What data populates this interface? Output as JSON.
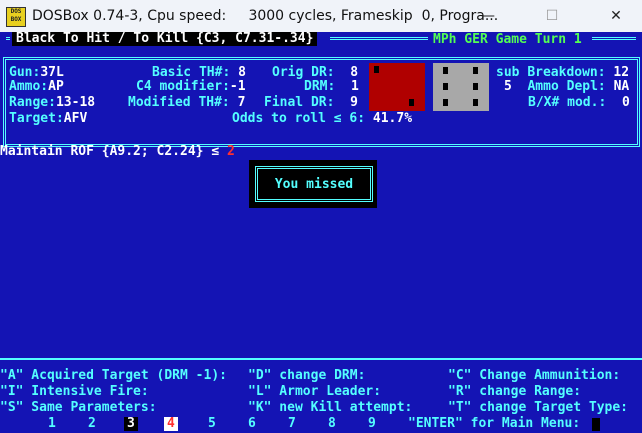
{
  "window": {
    "title": "DOSBox 0.74-3, Cpu speed:     3000 cycles, Frameskip  0, Progra...",
    "icon_text": "DOS BOX",
    "minimize": "—",
    "maximize": "☐",
    "close": "✕"
  },
  "header": {
    "title": "Black To Hit / To Kill {C3, C7.31-.34}",
    "turn": "MPh GER Game Turn 1"
  },
  "stats": {
    "gun_label": "Gun:",
    "gun_value": "37L",
    "ammo_label": "Ammo:",
    "ammo_value": "AP",
    "range_label": "Range:",
    "range_value": "13-18",
    "target_label": "Target:",
    "target_value": "AFV",
    "basic_th_label": "Basic TH#:",
    "basic_th_value": "8",
    "c4_label": "C4 modifier:",
    "c4_value": "-1",
    "modified_th_label": "Modified TH#:",
    "modified_th_value": "7",
    "orig_dr_label": "Orig DR:",
    "orig_dr_value": "8",
    "drm_label": "DRM:",
    "drm_value": "1",
    "final_dr_label": "Final DR:",
    "final_dr_value": "9",
    "odds_label": "Odds to roll ≤ 6:",
    "odds_value": "41.7%",
    "sub_label": "sub",
    "breakdown_label": "Breakdown:",
    "breakdown_value": "12",
    "depl_num": "5",
    "ammo_depl_label": "Ammo Depl:",
    "ammo_depl_value": "NA",
    "bx_label": "B/X# mod.:",
    "bx_value": "0"
  },
  "dice": {
    "red_value": 2,
    "white_value": 6
  },
  "rof": {
    "text": "Maintain ROF {A9.2; C2.24} ≤ ",
    "value": "2"
  },
  "popup": {
    "message": "You missed"
  },
  "menu": {
    "col1": [
      "\"A\" Acquired Target (DRM -1):",
      "\"I\" Intensive Fire:",
      "\"S\" Same Parameters:"
    ],
    "col2": [
      "\"D\" change DRM:",
      "\"L\" Armor Leader:",
      "\"K\" new Kill attempt:"
    ],
    "col3": [
      "\"C\" Change Ammunition:",
      "\"R\" change Range:",
      "\"T\" change Target Type:"
    ]
  },
  "keys": [
    "1",
    "2",
    "3",
    "4",
    "5",
    "6",
    "7",
    "8",
    "9"
  ],
  "enter_text": "\"ENTER\" for Main Menu:"
}
